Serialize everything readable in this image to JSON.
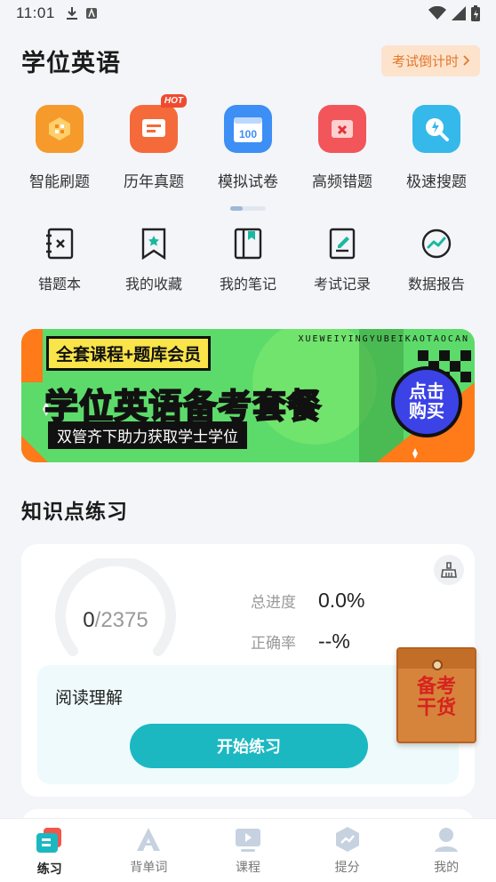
{
  "status_bar": {
    "time": "11:01"
  },
  "header": {
    "title": "学位英语",
    "countdown_label": "考试倒计时"
  },
  "primary_grid": [
    {
      "label": "智能刷题",
      "icon": "smart-practice-icon",
      "color": "#f59a2b"
    },
    {
      "label": "历年真题",
      "icon": "past-papers-icon",
      "color": "#f56a3a",
      "badge": "HOT"
    },
    {
      "label": "模拟试卷",
      "icon": "mock-exam-icon",
      "color": "#3d8ef5",
      "icon_text": "100"
    },
    {
      "label": "高频错题",
      "icon": "frequent-errors-icon",
      "color": "#f2565a"
    },
    {
      "label": "极速搜题",
      "icon": "quick-search-icon",
      "color": "#35b9ea"
    }
  ],
  "secondary_grid": [
    {
      "label": "错题本",
      "icon": "error-book-icon"
    },
    {
      "label": "我的收藏",
      "icon": "bookmark-icon"
    },
    {
      "label": "我的笔记",
      "icon": "notes-icon"
    },
    {
      "label": "考试记录",
      "icon": "exam-record-icon"
    },
    {
      "label": "数据报告",
      "icon": "data-report-icon"
    }
  ],
  "banner": {
    "badge": "全套课程+题库会员",
    "headline_main": "学位英语",
    "headline_accent": "备考套餐",
    "subtitle": "双管齐下助力获取学士学位",
    "marquee": "XUEWEIYINGYUBEIKAOTAOCAN",
    "buy_line1": "点击",
    "buy_line2": "购买"
  },
  "knowledge": {
    "section_title": "知识点练习",
    "done": "0",
    "total": "2375",
    "done_fraction": 0,
    "progress_label": "总进度",
    "progress_value": "0.0%",
    "accuracy_label": "正确率",
    "accuracy_value": "--%",
    "category": "阅读理解",
    "start_label": "开始练习"
  },
  "floating_promo": {
    "line1": "备考",
    "line2": "干货"
  },
  "tabbar": [
    {
      "label": "练习",
      "icon": "practice-tab-icon",
      "active": true
    },
    {
      "label": "背单词",
      "icon": "vocabulary-tab-icon",
      "active": false
    },
    {
      "label": "课程",
      "icon": "course-tab-icon",
      "active": false
    },
    {
      "label": "提分",
      "icon": "improve-tab-icon",
      "active": false
    },
    {
      "label": "我的",
      "icon": "profile-tab-icon",
      "active": false
    }
  ]
}
